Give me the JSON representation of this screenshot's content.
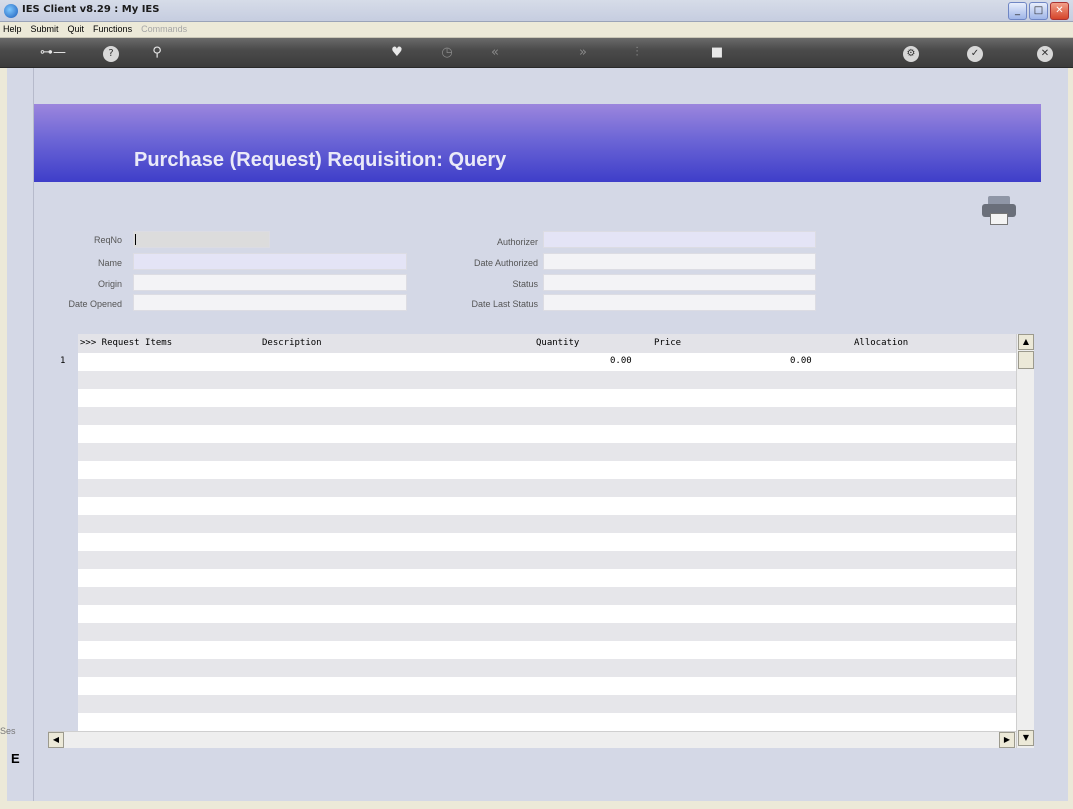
{
  "window": {
    "title": "IES Client v8.29 : My IES"
  },
  "menu": [
    {
      "label": "Help",
      "disabled": false
    },
    {
      "label": "Submit",
      "disabled": false
    },
    {
      "label": "Quit",
      "disabled": false
    },
    {
      "label": "Functions",
      "disabled": false
    },
    {
      "label": "Commands",
      "disabled": true
    }
  ],
  "toolbar": {
    "icons": [
      "key-icon",
      "help-icon",
      "search-icon",
      "heart-icon",
      "clock-icon",
      "rewind-icon",
      "fast-forward-icon",
      "tree-icon",
      "stop-icon",
      "settings-icon",
      "check-icon",
      "close-icon"
    ]
  },
  "page": {
    "title": "Purchase (Request) Requisition: Query"
  },
  "form": {
    "reqno_label": "ReqNo",
    "name_label": "Name",
    "origin_label": "Origin",
    "date_opened_label": "Date Opened",
    "authorizer_label": "Authorizer",
    "date_authorized_label": "Date Authorized",
    "status_label": "Status",
    "date_last_status_label": "Date Last Status",
    "reqno_value": "",
    "name_value": "",
    "origin_value": "",
    "date_opened_value": "",
    "authorizer_value": "",
    "date_authorized_value": "",
    "status_value": "",
    "date_last_status_value": ""
  },
  "grid": {
    "headers": {
      "items": ">>> Request Items",
      "description": "Description",
      "quantity": "Quantity",
      "price": "Price",
      "allocation": "Allocation"
    },
    "rows": [
      {
        "num": "1",
        "quantity": "0.00",
        "price": "0.00"
      }
    ]
  },
  "side": {
    "text": "Ses",
    "char": "E"
  }
}
